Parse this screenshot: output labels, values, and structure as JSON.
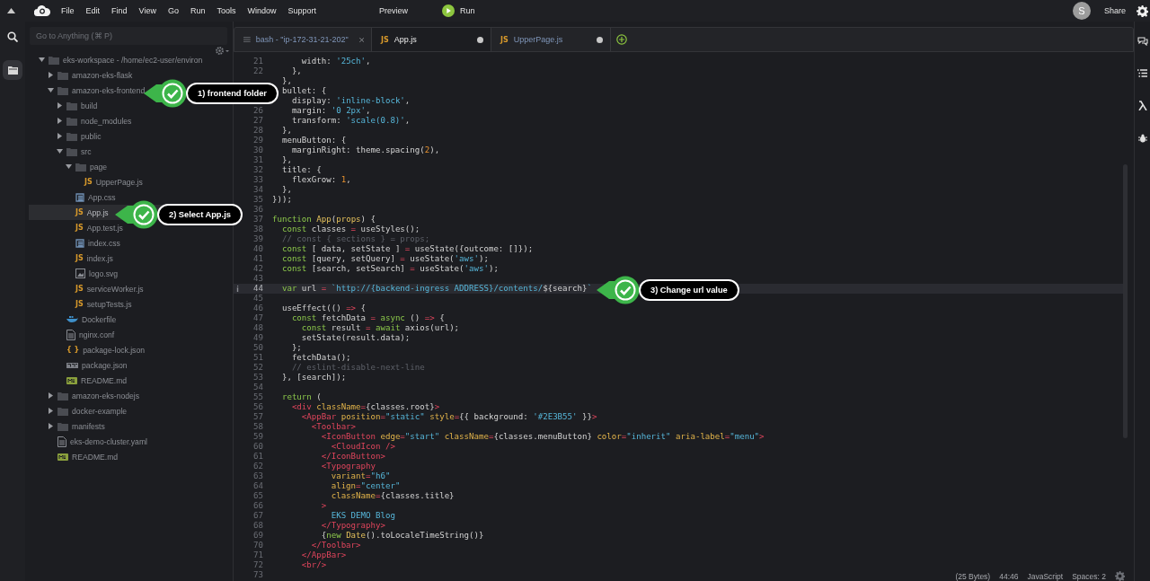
{
  "menu_bar": {
    "items": [
      "File",
      "Edit",
      "Find",
      "View",
      "Go",
      "Run",
      "Tools",
      "Window",
      "Support"
    ],
    "preview": "Preview",
    "run": "Run",
    "avatar": "S",
    "share": "Share"
  },
  "search": {
    "placeholder": "Go to Anything (⌘ P)"
  },
  "tree": [
    {
      "name": "eks-workspace - /home/ec2-user/environ",
      "kind": "folder",
      "expanded": true,
      "selected": false,
      "children": [
        {
          "name": "amazon-eks-flask",
          "kind": "folder",
          "expanded": false,
          "selected": false
        },
        {
          "name": "amazon-eks-frontend",
          "kind": "folder",
          "expanded": true,
          "selected": false,
          "children": [
            {
              "name": "build",
              "kind": "folder",
              "expanded": false,
              "selected": false
            },
            {
              "name": "node_modules",
              "kind": "folder",
              "expanded": false,
              "selected": false
            },
            {
              "name": "public",
              "kind": "folder",
              "expanded": false,
              "selected": false
            },
            {
              "name": "src",
              "kind": "folder",
              "expanded": true,
              "selected": false,
              "children": [
                {
                  "name": "page",
                  "kind": "folder",
                  "expanded": true,
                  "selected": false,
                  "children": [
                    {
                      "name": "UpperPage.js",
                      "kind": "js",
                      "badge": "JS",
                      "selected": false
                    }
                  ]
                },
                {
                  "name": "App.css",
                  "kind": "css",
                  "selected": false
                },
                {
                  "name": "App.js",
                  "kind": "js",
                  "badge": "JS",
                  "selected": true
                },
                {
                  "name": "App.test.js",
                  "kind": "js",
                  "badge": "JS",
                  "selected": false
                },
                {
                  "name": "index.css",
                  "kind": "css",
                  "selected": false
                },
                {
                  "name": "index.js",
                  "kind": "js",
                  "badge": "JS",
                  "selected": false
                },
                {
                  "name": "logo.svg",
                  "kind": "image",
                  "selected": false
                },
                {
                  "name": "serviceWorker.js",
                  "kind": "js",
                  "badge": "JS",
                  "selected": false
                },
                {
                  "name": "setupTests.js",
                  "kind": "js",
                  "badge": "JS",
                  "selected": false
                }
              ]
            },
            {
              "name": "Dockerfile",
              "kind": "docker",
              "selected": false
            },
            {
              "name": "nginx.conf",
              "kind": "text",
              "selected": false
            },
            {
              "name": "package-lock.json",
              "kind": "json",
              "badge": "{ }",
              "selected": false
            },
            {
              "name": "package.json",
              "kind": "npm",
              "selected": false
            },
            {
              "name": "README.md",
              "kind": "markdown",
              "selected": false
            }
          ]
        },
        {
          "name": "amazon-eks-nodejs",
          "kind": "folder",
          "expanded": false,
          "selected": false
        },
        {
          "name": "docker-example",
          "kind": "folder",
          "expanded": false,
          "selected": false
        },
        {
          "name": "manifests",
          "kind": "folder",
          "expanded": false,
          "selected": false
        },
        {
          "name": "eks-demo-cluster.yaml",
          "kind": "text",
          "selected": false
        },
        {
          "name": "README.md",
          "kind": "markdown",
          "selected": false
        }
      ]
    }
  ],
  "tabs": [
    {
      "kind": "terminal",
      "label": "bash - \"ip-172-31-21-202\"",
      "selected": false,
      "modified": false
    },
    {
      "kind": "file",
      "badge": "JS",
      "label": "App.js",
      "selected": true,
      "modified": true
    },
    {
      "kind": "file",
      "badge": "JS",
      "label": "UpperPage.js",
      "selected": false,
      "modified": true
    }
  ],
  "editor": {
    "lines": [
      {
        "number": "21",
        "active": false,
        "tokens": [
          {
            "kind": "plain",
            "text": "      width: "
          },
          {
            "kind": "string",
            "text": "'25ch'"
          },
          {
            "kind": "plain",
            "text": ","
          }
        ]
      },
      {
        "number": "22",
        "active": false,
        "tokens": [
          {
            "kind": "plain",
            "text": "    },"
          }
        ]
      },
      {
        "active": false,
        "tokens": [
          {
            "kind": "plain",
            "text": "  },"
          }
        ]
      },
      {
        "active": false,
        "tokens": [
          {
            "kind": "plain",
            "text": "  bullet: {"
          }
        ]
      },
      {
        "active": false,
        "tokens": [
          {
            "kind": "plain",
            "text": "    display: "
          },
          {
            "kind": "string",
            "text": "'inline-block'"
          },
          {
            "kind": "plain",
            "text": ","
          }
        ]
      },
      {
        "number": "26",
        "active": false,
        "tokens": [
          {
            "kind": "plain",
            "text": "    margin: "
          },
          {
            "kind": "string",
            "text": "'0 2px'"
          },
          {
            "kind": "plain",
            "text": ","
          }
        ]
      },
      {
        "number": "27",
        "active": false,
        "tokens": [
          {
            "kind": "plain",
            "text": "    transform: "
          },
          {
            "kind": "string",
            "text": "'scale(0.8)'"
          },
          {
            "kind": "plain",
            "text": ","
          }
        ]
      },
      {
        "number": "28",
        "active": false,
        "tokens": [
          {
            "kind": "plain",
            "text": "  },"
          }
        ]
      },
      {
        "number": "29",
        "active": false,
        "tokens": [
          {
            "kind": "plain",
            "text": "  menuButton: {"
          }
        ]
      },
      {
        "number": "30",
        "active": false,
        "tokens": [
          {
            "kind": "plain",
            "text": "    marginRight: theme.spacing("
          },
          {
            "kind": "number",
            "text": "2"
          },
          {
            "kind": "plain",
            "text": "),"
          }
        ]
      },
      {
        "number": "31",
        "active": false,
        "tokens": [
          {
            "kind": "plain",
            "text": "  },"
          }
        ]
      },
      {
        "number": "32",
        "active": false,
        "tokens": [
          {
            "kind": "plain",
            "text": "  title: {"
          }
        ]
      },
      {
        "number": "33",
        "active": false,
        "tokens": [
          {
            "kind": "plain",
            "text": "    flexGrow: "
          },
          {
            "kind": "number",
            "text": "1"
          },
          {
            "kind": "plain",
            "text": ","
          }
        ]
      },
      {
        "number": "34",
        "active": false,
        "tokens": [
          {
            "kind": "plain",
            "text": "  },"
          }
        ]
      },
      {
        "number": "35",
        "active": false,
        "tokens": [
          {
            "kind": "plain",
            "text": "}));"
          }
        ]
      },
      {
        "number": "36",
        "active": false
      },
      {
        "number": "37",
        "active": false,
        "tokens": [
          {
            "kind": "keyword",
            "text": "function"
          },
          {
            "kind": "name",
            "text": " App"
          },
          {
            "kind": "plain",
            "text": "("
          },
          {
            "kind": "name",
            "text": "props"
          },
          {
            "kind": "plain",
            "text": ") {"
          }
        ]
      },
      {
        "number": "38",
        "active": false,
        "tokens": [
          {
            "kind": "keyword",
            "text": "  const"
          },
          {
            "kind": "plain",
            "text": " classes "
          },
          {
            "kind": "operator",
            "text": "="
          },
          {
            "kind": "plain",
            "text": " useStyles();"
          }
        ]
      },
      {
        "number": "39",
        "active": false,
        "tokens": [
          {
            "kind": "comment",
            "text": "  // const { sections } = props;"
          }
        ]
      },
      {
        "number": "40",
        "active": false,
        "tokens": [
          {
            "kind": "keyword",
            "text": "  const"
          },
          {
            "kind": "plain",
            "text": " [ data, setState ] "
          },
          {
            "kind": "operator",
            "text": "="
          },
          {
            "kind": "plain",
            "text": " useState({outcome: []});"
          }
        ]
      },
      {
        "number": "41",
        "active": false,
        "tokens": [
          {
            "kind": "keyword",
            "text": "  const"
          },
          {
            "kind": "plain",
            "text": " [query, setQuery] "
          },
          {
            "kind": "operator",
            "text": "="
          },
          {
            "kind": "plain",
            "text": " useState("
          },
          {
            "kind": "string",
            "text": "'aws'"
          },
          {
            "kind": "plain",
            "text": ");"
          }
        ]
      },
      {
        "number": "42",
        "active": false,
        "tokens": [
          {
            "kind": "keyword",
            "text": "  const"
          },
          {
            "kind": "plain",
            "text": " [search, setSearch] "
          },
          {
            "kind": "operator",
            "text": "="
          },
          {
            "kind": "plain",
            "text": " useState("
          },
          {
            "kind": "string",
            "text": "'aws'"
          },
          {
            "kind": "plain",
            "text": ");"
          }
        ]
      },
      {
        "number": "43",
        "active": false
      },
      {
        "number": "44",
        "active": true,
        "tokens": [
          {
            "kind": "keyword",
            "text": "  var"
          },
          {
            "kind": "plain",
            "text": " url "
          },
          {
            "kind": "operator",
            "text": "="
          },
          {
            "kind": "string",
            "text": " `http://{backend-ingress ADDRESS}/contents/"
          },
          {
            "kind": "plain",
            "text": "${search}"
          },
          {
            "kind": "string",
            "text": "`"
          }
        ]
      },
      {
        "number": "45",
        "active": false
      },
      {
        "number": "46",
        "active": false,
        "tokens": [
          {
            "kind": "plain",
            "text": "  useEffect(() "
          },
          {
            "kind": "operator",
            "text": "=>"
          },
          {
            "kind": "plain",
            "text": " {"
          }
        ]
      },
      {
        "number": "47",
        "active": false,
        "tokens": [
          {
            "kind": "keyword",
            "text": "    const"
          },
          {
            "kind": "plain",
            "text": " fetchData "
          },
          {
            "kind": "operator",
            "text": "="
          },
          {
            "kind": "keyword",
            "text": " async"
          },
          {
            "kind": "plain",
            "text": " () "
          },
          {
            "kind": "operator",
            "text": "=>"
          },
          {
            "kind": "plain",
            "text": " {"
          }
        ]
      },
      {
        "number": "48",
        "active": false,
        "tokens": [
          {
            "kind": "keyword",
            "text": "      const"
          },
          {
            "kind": "plain",
            "text": " result "
          },
          {
            "kind": "operator",
            "text": "="
          },
          {
            "kind": "keyword",
            "text": " await"
          },
          {
            "kind": "plain",
            "text": " axios(url);"
          }
        ]
      },
      {
        "number": "49",
        "active": false,
        "tokens": [
          {
            "kind": "plain",
            "text": "      setState(result.data);"
          }
        ]
      },
      {
        "number": "50",
        "active": false,
        "tokens": [
          {
            "kind": "plain",
            "text": "    };"
          }
        ]
      },
      {
        "number": "51",
        "active": false,
        "tokens": [
          {
            "kind": "plain",
            "text": "    fetchData();"
          }
        ]
      },
      {
        "number": "52",
        "active": false,
        "tokens": [
          {
            "kind": "comment",
            "text": "    // eslint-disable-next-line"
          }
        ]
      },
      {
        "number": "53",
        "active": false,
        "tokens": [
          {
            "kind": "plain",
            "text": "  }, [search]);"
          }
        ]
      },
      {
        "number": "54",
        "active": false
      },
      {
        "number": "55",
        "active": false,
        "tokens": [
          {
            "kind": "keyword",
            "text": "  return"
          },
          {
            "kind": "plain",
            "text": " ("
          }
        ]
      },
      {
        "number": "56",
        "active": false,
        "tokens": [
          {
            "kind": "tag",
            "text": "    <div"
          },
          {
            "kind": "attr",
            "text": " className"
          },
          {
            "kind": "operator",
            "text": "="
          },
          {
            "kind": "plain",
            "text": "{classes.root}"
          },
          {
            "kind": "tag",
            "text": ">"
          }
        ]
      },
      {
        "number": "57",
        "active": false,
        "tokens": [
          {
            "kind": "tag",
            "text": "      <AppBar"
          },
          {
            "kind": "attr",
            "text": " position"
          },
          {
            "kind": "operator",
            "text": "="
          },
          {
            "kind": "string",
            "text": "\"static\""
          },
          {
            "kind": "attr",
            "text": " style"
          },
          {
            "kind": "operator",
            "text": "="
          },
          {
            "kind": "plain",
            "text": "{{ background: "
          },
          {
            "kind": "string",
            "text": "'#2E3B55'"
          },
          {
            "kind": "plain",
            "text": " }}"
          },
          {
            "kind": "tag",
            "text": ">"
          }
        ]
      },
      {
        "number": "58",
        "active": false,
        "tokens": [
          {
            "kind": "tag",
            "text": "        <Toolbar>"
          }
        ]
      },
      {
        "number": "59",
        "active": false,
        "tokens": [
          {
            "kind": "tag",
            "text": "          <IconButton"
          },
          {
            "kind": "attr",
            "text": " edge"
          },
          {
            "kind": "operator",
            "text": "="
          },
          {
            "kind": "string",
            "text": "\"start\""
          },
          {
            "kind": "attr",
            "text": " className"
          },
          {
            "kind": "operator",
            "text": "="
          },
          {
            "kind": "plain",
            "text": "{classes.menuButton} "
          },
          {
            "kind": "attr",
            "text": "color"
          },
          {
            "kind": "operator",
            "text": "="
          },
          {
            "kind": "string",
            "text": "\"inherit\""
          },
          {
            "kind": "attr",
            "text": " aria-label"
          },
          {
            "kind": "operator",
            "text": "="
          },
          {
            "kind": "string",
            "text": "\"menu\""
          },
          {
            "kind": "tag",
            "text": ">"
          }
        ]
      },
      {
        "number": "60",
        "active": false,
        "tokens": [
          {
            "kind": "tag",
            "text": "            <CloudIcon />"
          }
        ]
      },
      {
        "number": "61",
        "active": false,
        "tokens": [
          {
            "kind": "tag",
            "text": "          </IconButton>"
          }
        ]
      },
      {
        "number": "62",
        "active": false,
        "tokens": [
          {
            "kind": "tag",
            "text": "          <Typography"
          }
        ]
      },
      {
        "number": "63",
        "active": false,
        "tokens": [
          {
            "kind": "attr",
            "text": "            variant"
          },
          {
            "kind": "operator",
            "text": "="
          },
          {
            "kind": "string",
            "text": "\"h6\""
          }
        ]
      },
      {
        "number": "64",
        "active": false,
        "tokens": [
          {
            "kind": "attr",
            "text": "            align"
          },
          {
            "kind": "operator",
            "text": "="
          },
          {
            "kind": "string",
            "text": "\"center\""
          }
        ]
      },
      {
        "number": "65",
        "active": false,
        "tokens": [
          {
            "kind": "attr",
            "text": "            className"
          },
          {
            "kind": "operator",
            "text": "="
          },
          {
            "kind": "plain",
            "text": "{classes.title}"
          }
        ]
      },
      {
        "number": "66",
        "active": false,
        "tokens": [
          {
            "kind": "tag",
            "text": "          >"
          }
        ]
      },
      {
        "number": "67",
        "active": false,
        "tokens": [
          {
            "kind": "string",
            "text": "            EKS DEMO Blog"
          }
        ]
      },
      {
        "number": "68",
        "active": false,
        "tokens": [
          {
            "kind": "tag",
            "text": "          </Typography>"
          }
        ]
      },
      {
        "number": "69",
        "active": false,
        "tokens": [
          {
            "kind": "plain",
            "text": "          {"
          },
          {
            "kind": "keyword",
            "text": "new"
          },
          {
            "kind": "name",
            "text": " Date"
          },
          {
            "kind": "plain",
            "text": "().toLocaleTimeString()}"
          }
        ]
      },
      {
        "number": "70",
        "active": false,
        "tokens": [
          {
            "kind": "tag",
            "text": "        </Toolbar>"
          }
        ]
      },
      {
        "number": "71",
        "active": false,
        "tokens": [
          {
            "kind": "tag",
            "text": "      </AppBar>"
          }
        ]
      },
      {
        "number": "72",
        "active": false,
        "tokens": [
          {
            "kind": "tag",
            "text": "      <br/>"
          }
        ]
      },
      {
        "number": "73",
        "active": false
      }
    ]
  },
  "status_bar": {
    "size": "(25 Bytes)",
    "position": "44:46",
    "language": "JavaScript",
    "indent": "Spaces: 2"
  },
  "callouts": [
    "1) frontend folder",
    "2) Select App.js",
    "3) Change url value"
  ]
}
